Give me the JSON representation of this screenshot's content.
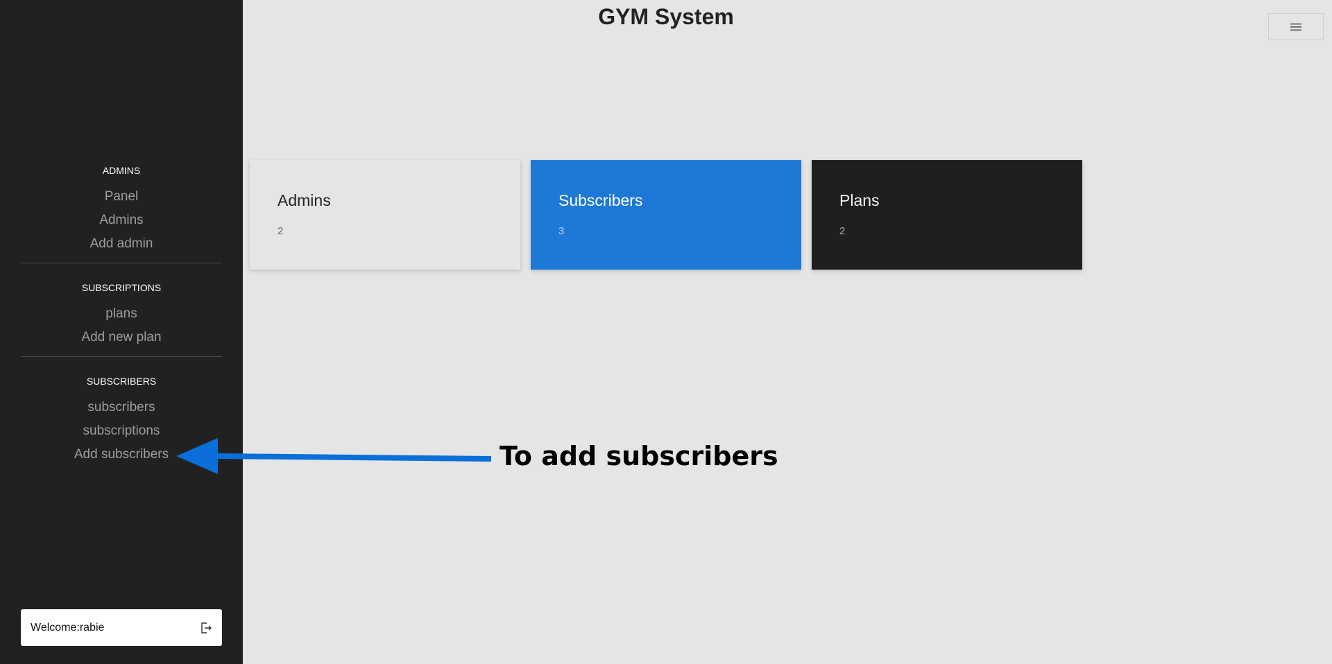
{
  "app": {
    "title": "GYM System"
  },
  "sidebar": {
    "sections": [
      {
        "header": "ADMINS",
        "items": [
          {
            "label": "Panel"
          },
          {
            "label": "Admins"
          },
          {
            "label": "Add admin"
          }
        ]
      },
      {
        "header": "SUBSCRIPTIONS",
        "items": [
          {
            "label": "plans"
          },
          {
            "label": "Add new plan"
          }
        ]
      },
      {
        "header": "SUBSCRIBERS",
        "items": [
          {
            "label": "subscribers"
          },
          {
            "label": "subscriptions"
          },
          {
            "label": "Add subscribers"
          }
        ]
      }
    ],
    "welcome": {
      "text": "Welcome:rabie",
      "icon": "logout-icon"
    }
  },
  "header": {
    "menu_icon": "hamburger-menu-icon"
  },
  "cards": [
    {
      "title": "Admins",
      "count": "2",
      "color": "#e5e5e5"
    },
    {
      "title": "Subscribers",
      "count": "3",
      "color": "#1e78d6"
    },
    {
      "title": "Plans",
      "count": "2",
      "color": "#1f1f1f"
    }
  ],
  "annotation": {
    "text": "To add subscribers",
    "arrow_color": "#0a6fd8"
  }
}
